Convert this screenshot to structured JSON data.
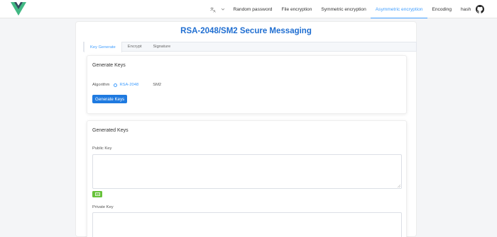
{
  "header": {
    "lang_icon": "translate-icon",
    "nav": [
      {
        "label": "Random password",
        "active": false
      },
      {
        "label": "File encryption",
        "active": false
      },
      {
        "label": "Symmetric encryption",
        "active": false
      },
      {
        "label": "Asymmetric encryption",
        "active": true
      },
      {
        "label": "Encoding",
        "active": false
      },
      {
        "label": "hash",
        "active": false
      }
    ],
    "github_icon": "github-icon"
  },
  "main": {
    "title": "RSA-2048/SM2 Secure Messaging",
    "tabs": [
      {
        "label": "Key Generate",
        "active": true
      },
      {
        "label": "Encrypt",
        "active": false
      },
      {
        "label": "Signature",
        "active": false
      }
    ],
    "generate": {
      "title": "Generate Keys",
      "algorithm_label": "Algorithm",
      "options": [
        {
          "label": "RSA-2048",
          "checked": true
        },
        {
          "label": "SM2",
          "checked": false
        }
      ],
      "button": "Generate Keys"
    },
    "generated": {
      "title": "Generated Keys",
      "public_label": "Public Key",
      "public_value": "",
      "private_label": "Private Key",
      "private_value": ""
    }
  },
  "colors": {
    "accent": "#409eff",
    "title": "#1f6ed1",
    "primary_button": "#1f7ae0",
    "copy_button": "#67c23a",
    "logo_green": "#41b883",
    "logo_dark": "#35495e"
  }
}
